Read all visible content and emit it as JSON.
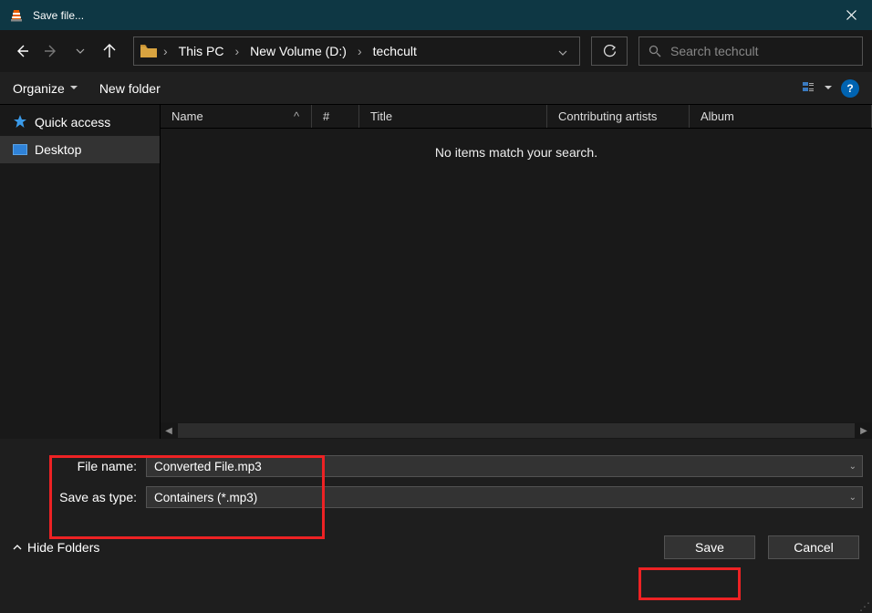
{
  "title": "Save file...",
  "breadcrumb": {
    "items": [
      "This PC",
      "New Volume (D:)",
      "techcult"
    ]
  },
  "search": {
    "placeholder": "Search techcult"
  },
  "toolbar": {
    "organize": "Organize",
    "newfolder": "New folder",
    "help": "?"
  },
  "sidebar": {
    "quick_access": "Quick access",
    "desktop": "Desktop"
  },
  "columns": {
    "name": "Name",
    "num": "#",
    "title": "Title",
    "contrib": "Contributing artists",
    "album": "Album"
  },
  "empty_msg": "No items match your search.",
  "fields": {
    "filename_label": "File name:",
    "filename_value": "Converted File.mp3",
    "saveas_label": "Save as type:",
    "saveas_value": "Containers (*.mp3)"
  },
  "footer": {
    "hide": "Hide Folders",
    "save": "Save",
    "cancel": "Cancel"
  }
}
